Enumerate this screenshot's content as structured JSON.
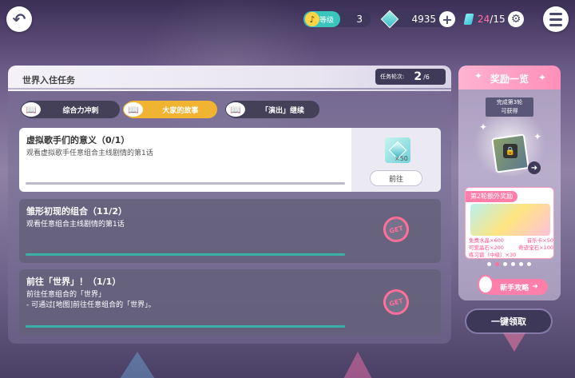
{
  "topbar": {
    "level_label": "等级",
    "level_value": "3",
    "gems": "4935",
    "ticket_current": "24",
    "ticket_max": "/15"
  },
  "panel": {
    "title": "世界入住任务",
    "round_label": "任务轮次:",
    "round_current": "2",
    "round_total": "/6"
  },
  "tabs": [
    {
      "label": "综合力冲刺",
      "active": false
    },
    {
      "label": "大家的故事",
      "active": true
    },
    {
      "label": "「演出」继续",
      "active": false
    }
  ],
  "tasks": [
    {
      "title": "虚拟歌手们的意义（0/1）",
      "desc": "观看虚拟歌手任意组合主线剧情的第1话",
      "progress": 0,
      "reward_qty": "×50",
      "button": "前往",
      "state": "active"
    },
    {
      "title": "雏形初现的组合（11/2）",
      "desc": "观看任意组合主线剧情的第1话",
      "progress": 1,
      "stamp": "GET",
      "state": "done"
    },
    {
      "title": "前往「世界」！（1/1）",
      "desc_line1": "前往任意组合的「世界」",
      "desc_line2": "- 可通过[地图]前往任意组合的「世界」。",
      "progress": 1,
      "stamp": "GET",
      "state": "done"
    }
  ],
  "reward_panel": {
    "title": "奖励一览",
    "condition_line1": "完成第3轮",
    "condition_line2": "可获得",
    "bonus_label": "第2轮额外奖励",
    "bonus_items": [
      [
        "免费水晶×600",
        "音乐卡×50"
      ],
      [
        "可爱晶石×200",
        "奇迹宝石×100"
      ],
      [
        "练习谱（中级）×30",
        ""
      ]
    ],
    "guide_button": "新手攻略",
    "dot_count": 6,
    "active_dot": 1
  },
  "claim_button": "一键领取"
}
